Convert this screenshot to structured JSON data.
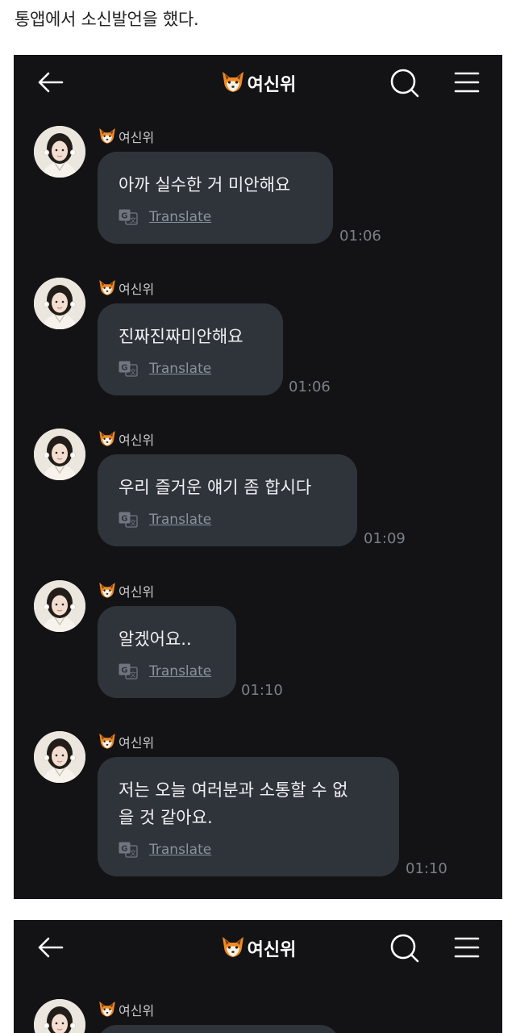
{
  "post": {
    "title": "통앱에서 소신발언을 했다."
  },
  "screenshots": [
    {
      "header": {
        "title": "여신위"
      },
      "messages": [
        {
          "sender": "여신위",
          "text": "아까 실수한 거 미안해요",
          "translate": "Translate",
          "time": "01:06"
        },
        {
          "sender": "여신위",
          "text": "진짜진짜미안해요",
          "translate": "Translate",
          "time": "01:06"
        },
        {
          "sender": "여신위",
          "text": "우리 즐거운 얘기 좀 합시다",
          "translate": "Translate",
          "time": "01:09"
        },
        {
          "sender": "여신위",
          "text": "알겠어요..",
          "translate": "Translate",
          "time": "01:10"
        },
        {
          "sender": "여신위",
          "text": "저는 오늘 여러분과 소통할 수 없\n을 것 같아요.",
          "translate": "Translate",
          "time": "01:10"
        }
      ]
    },
    {
      "header": {
        "title": "여신위"
      },
      "messages": [
        {
          "sender": "여신위"
        }
      ]
    }
  ],
  "colors": {
    "background": "#131315",
    "bubble": "#2f343b",
    "message_text": "#f1f1f3",
    "timestamp": "#7b7f86",
    "translate_link": "#8b929c"
  },
  "icons": [
    "back-arrow-icon",
    "fox-emoji-icon",
    "search-icon",
    "hamburger-menu-icon",
    "google-translate-icon",
    "avatar-photo"
  ]
}
